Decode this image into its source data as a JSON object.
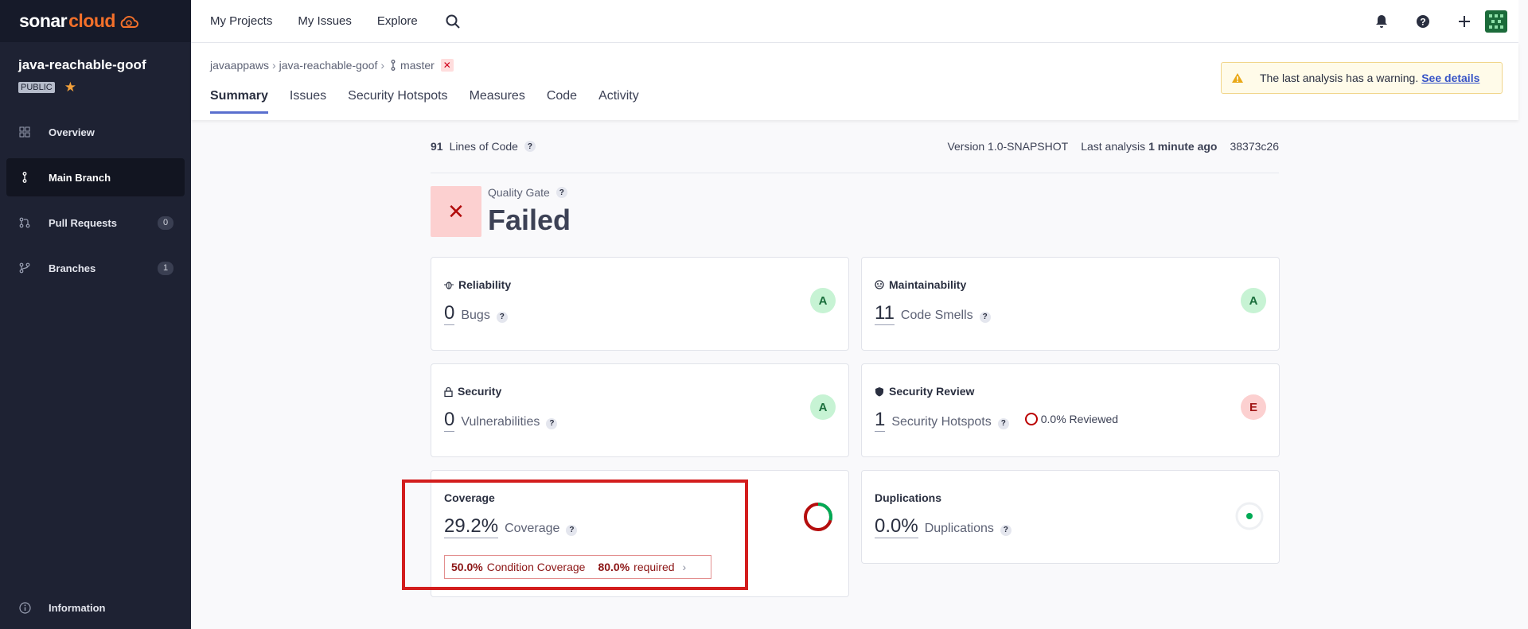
{
  "sidebar": {
    "brand": {
      "sonar": "sonar",
      "cloud": "cloud"
    },
    "project_name": "java-reachable-goof",
    "visibility": "PUBLIC",
    "items": [
      {
        "label": "Overview",
        "icon": "grid-icon"
      },
      {
        "label": "Main Branch",
        "icon": "branch-icon"
      },
      {
        "label": "Pull Requests",
        "icon": "pull-request-icon",
        "count": "0"
      },
      {
        "label": "Branches",
        "icon": "branches-icon",
        "count": "1"
      }
    ],
    "information": "Information"
  },
  "topbar": {
    "nav": [
      "My Projects",
      "My Issues",
      "Explore"
    ]
  },
  "breadcrumb": {
    "org": "javaappaws",
    "project": "java-reachable-goof",
    "branch": "master",
    "fail_mark": "✕"
  },
  "tabs": [
    "Summary",
    "Issues",
    "Security Hotspots",
    "Measures",
    "Code",
    "Activity"
  ],
  "warning": {
    "text": "The last analysis has a warning.",
    "link": "See details"
  },
  "meta": {
    "loc_value": "91",
    "loc_label": "Lines of Code",
    "version": "Version 1.0-SNAPSHOT",
    "last_analysis_label": "Last analysis",
    "last_analysis_value": "1 minute ago",
    "commit": "38373c26"
  },
  "quality_gate": {
    "label": "Quality Gate",
    "status": "Failed",
    "icon": "✕"
  },
  "cards": {
    "reliability": {
      "title": "Reliability",
      "value": "0",
      "unit": "Bugs",
      "rating": "A"
    },
    "maintainability": {
      "title": "Maintainability",
      "value": "11",
      "unit": "Code Smells",
      "rating": "A"
    },
    "security": {
      "title": "Security",
      "value": "0",
      "unit": "Vulnerabilities",
      "rating": "A"
    },
    "security_review": {
      "title": "Security Review",
      "value": "1",
      "unit": "Security Hotspots",
      "reviewed": "0.0% Reviewed",
      "rating": "E"
    },
    "coverage": {
      "title": "Coverage",
      "value": "29.2%",
      "unit": "Coverage",
      "cond_value": "50.0%",
      "cond_label": "Condition Coverage",
      "req_value": "80.0%",
      "req_label": "required",
      "percent": 29.2
    },
    "duplications": {
      "title": "Duplications",
      "value": "0.0%",
      "unit": "Duplications"
    }
  },
  "colors": {
    "sidebar_bg": "#1e2233",
    "accent": "#5a6fce",
    "fail": "#d31d1d",
    "rating_a": "#c7f3d4",
    "rating_e": "#fcd0d0"
  }
}
